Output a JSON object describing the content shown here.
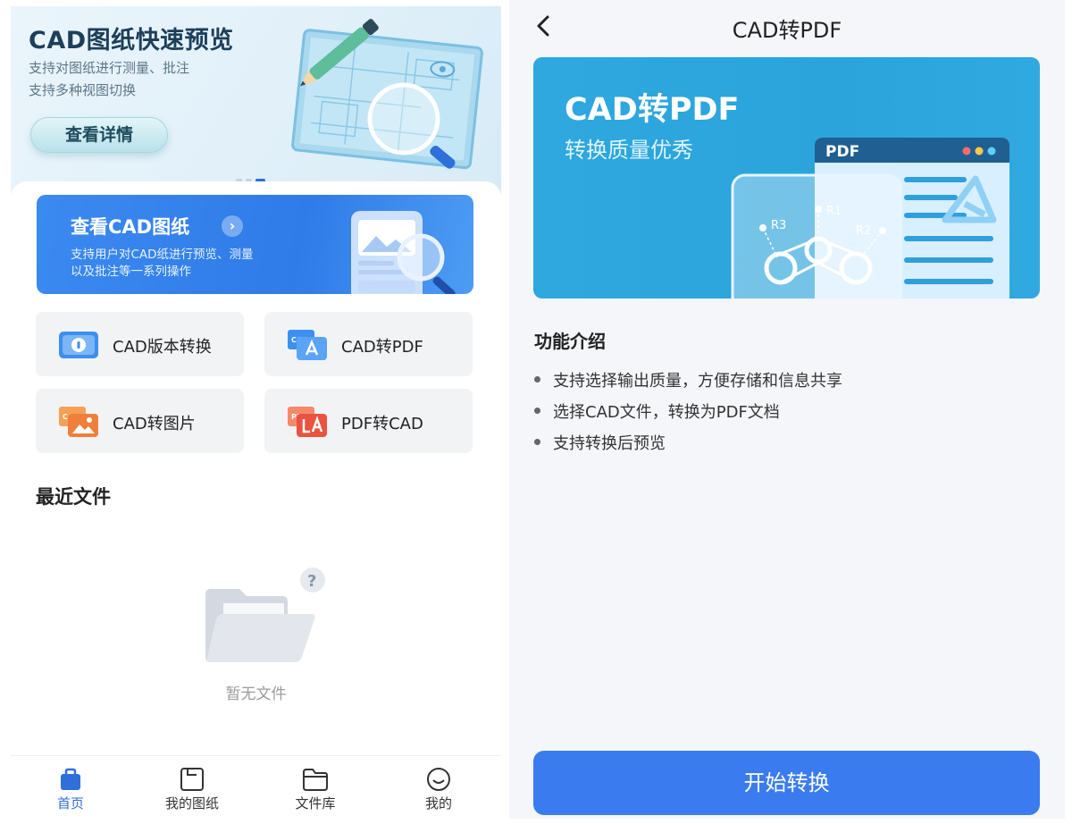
{
  "left": {
    "hero": {
      "title": "CAD图纸快速预览",
      "subtitle_line1": "支持对图纸进行测量、批注",
      "subtitle_line2": "支持多种视图切换",
      "button_label": "查看详情",
      "illustration_icon": "blueprint-pencil-magnifier-icon"
    },
    "view_banner": {
      "title": "查看CAD图纸",
      "desc_line1": "支持用户对CAD纸进行预览、测量",
      "desc_line2": "以及批注等一系列操作",
      "illustration_icon": "phone-magnifier-icon"
    },
    "tools": [
      {
        "label": "CAD版本转换",
        "icon": "version-convert-icon"
      },
      {
        "label": "CAD转PDF",
        "icon": "cad-to-pdf-icon"
      },
      {
        "label": "CAD转图片",
        "icon": "cad-to-image-icon"
      },
      {
        "label": "PDF转CAD",
        "icon": "pdf-to-cad-icon"
      }
    ],
    "recent": {
      "title": "最近文件",
      "empty_text": "暂无文件",
      "empty_icon": "empty-folder-icon"
    },
    "tabbar": [
      {
        "label": "首页",
        "icon": "home-icon",
        "active": true
      },
      {
        "label": "我的图纸",
        "icon": "drawing-icon",
        "active": false
      },
      {
        "label": "文件库",
        "icon": "folder-icon",
        "active": false
      },
      {
        "label": "我的",
        "icon": "smiley-icon",
        "active": false
      }
    ]
  },
  "right": {
    "header": {
      "title": "CAD转PDF",
      "back_icon": "back-chevron-icon"
    },
    "banner": {
      "title": "CAD转PDF",
      "subtitle": "转换质量优秀",
      "doc_label": "PDF",
      "part_labels": [
        "R3",
        "R1",
        "R2"
      ]
    },
    "intro": {
      "title": "功能介绍",
      "features": [
        "支持选择输出质量，方便存储和信息共享",
        "选择CAD文件，转换为PDF文档",
        "支持转换后预览"
      ]
    },
    "start_button": "开始转换"
  },
  "colors": {
    "primary_blue": "#3a7cf0",
    "banner_cyan": "#2ba4dc",
    "tab_active": "#2f6fd9"
  }
}
